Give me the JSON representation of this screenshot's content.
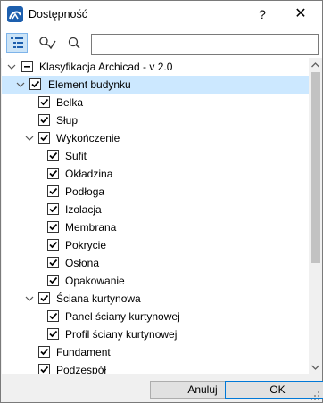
{
  "window": {
    "title": "Dostępność",
    "help_label": "?",
    "close_label": "✕"
  },
  "toolbar": {
    "search_placeholder": "",
    "search_value": ""
  },
  "tree": {
    "root": {
      "label": "Klasyfikacja Archicad - v 2.0"
    },
    "items": [
      {
        "label": "Element budynku",
        "checked": true,
        "expanded": true,
        "selected": true
      },
      {
        "label": "Belka",
        "checked": true
      },
      {
        "label": "Słup",
        "checked": true
      },
      {
        "label": "Wykończenie",
        "checked": true,
        "expanded": true
      },
      {
        "label": "Sufit",
        "checked": true
      },
      {
        "label": "Okładzina",
        "checked": true
      },
      {
        "label": "Podłoga",
        "checked": true
      },
      {
        "label": "Izolacja",
        "checked": true
      },
      {
        "label": "Membrana",
        "checked": true
      },
      {
        "label": "Pokrycie",
        "checked": true
      },
      {
        "label": "Osłona",
        "checked": true
      },
      {
        "label": "Opakowanie",
        "checked": true
      },
      {
        "label": "Ściana kurtynowa",
        "checked": true,
        "expanded": true
      },
      {
        "label": "Panel ściany kurtynowej",
        "checked": true
      },
      {
        "label": "Profil ściany kurtynowej",
        "checked": true
      },
      {
        "label": "Fundament",
        "checked": true
      },
      {
        "label": "Podzespół",
        "checked": true
      }
    ]
  },
  "footer": {
    "cancel_label": "Anuluj",
    "ok_label": "OK"
  },
  "colors": {
    "selection": "#cce8ff",
    "accent": "#0078d7"
  }
}
